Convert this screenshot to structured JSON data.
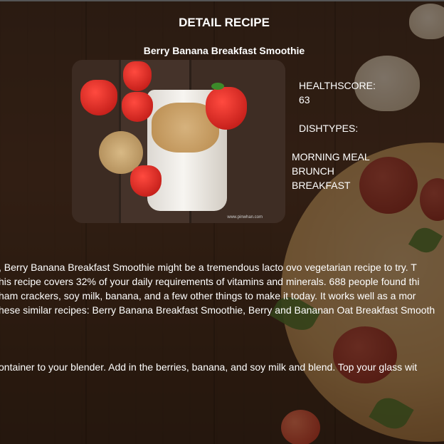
{
  "header": {
    "title": "DETAIL RECIPE"
  },
  "recipe": {
    "name": "Berry Banana Breakfast Smoothie",
    "image_watermark": "www.pinwhan.com",
    "healthscore_label": "HEALTHSCORE:",
    "healthscore_value": "63",
    "dishtypes_label": "DISHTYPES:",
    "dishtypes": [
      "MORNING MEAL",
      "BRUNCH",
      "BREAKFAST"
    ],
    "summary_lines": [
      ", Berry Banana Breakfast Smoothie might be a tremendous lacto ovo vegetarian recipe to try. T",
      "his recipe covers 32% of your daily requirements of vitamins and minerals. 688 people found thi",
      "ham crackers, soy milk, banana, and a few other things to make it today. It works well as a mor",
      "hese similar recipes: Berry Banana Breakfast Smoothie, Berry and Bananan Oat Breakfast Smooth"
    ],
    "instructions_line": "ontainer to your blender. Add in the berries, banana, and soy milk and blend. Top your glass wit"
  }
}
